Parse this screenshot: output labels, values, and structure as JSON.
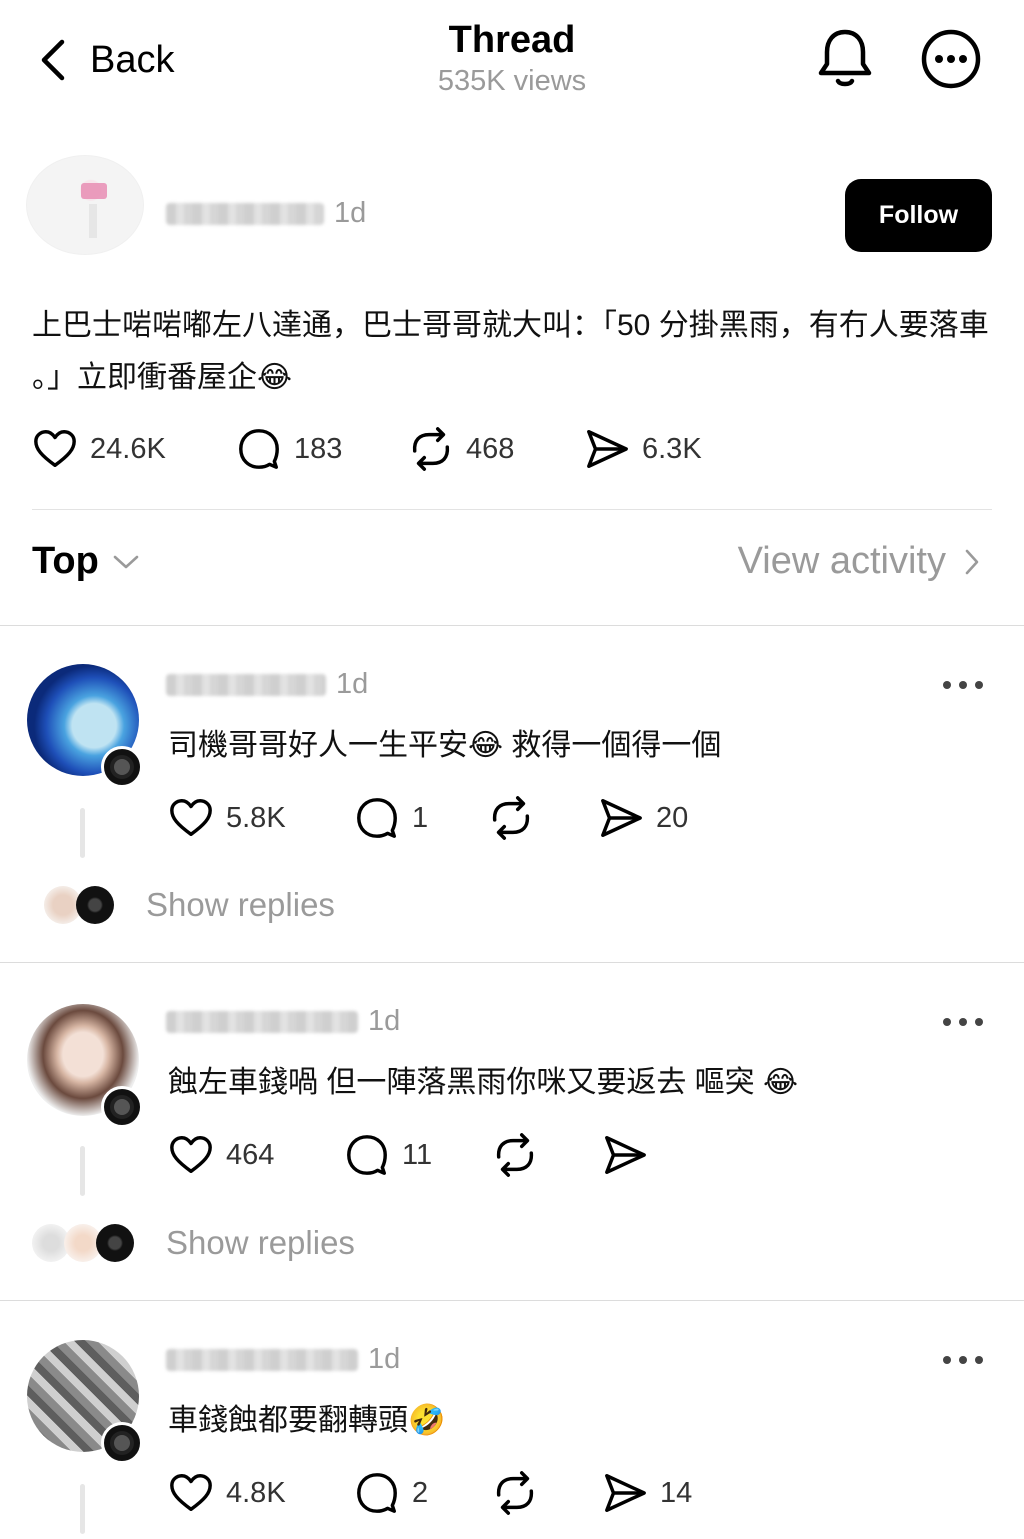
{
  "header": {
    "back_label": "Back",
    "title": "Thread",
    "views": "535K views"
  },
  "main_post": {
    "time": "1d",
    "follow_label": "Follow",
    "text": "上巴士啱啱嘟左八達通，巴士哥哥就大叫：「50 分掛黑雨，有冇人要落車 。」立即衝番屋企😂",
    "likes": "24.6K",
    "comments": "183",
    "reposts": "468",
    "shares": "6.3K"
  },
  "sort": {
    "label": "Top",
    "view_activity": "View activity"
  },
  "replies": [
    {
      "time": "1d",
      "text": "司機哥哥好人一生平安😂 救得一個得一個",
      "likes": "5.8K",
      "comments": "1",
      "reposts": "",
      "shares": "20",
      "show_replies": "Show replies"
    },
    {
      "time": "1d",
      "text": "蝕左車錢喎 但一陣落黑雨你咪又要返去 嘔突 😂",
      "likes": "464",
      "comments": "11",
      "reposts": "",
      "shares": "",
      "show_replies": "Show replies"
    },
    {
      "time": "1d",
      "text": "車錢蝕都要翻轉頭🤣",
      "likes": "4.8K",
      "comments": "2",
      "reposts": "",
      "shares": "14"
    }
  ],
  "icons": {
    "back": "chevron-left-icon",
    "bell": "bell-icon",
    "more": "more-circle-icon",
    "like": "heart-icon",
    "comment": "comment-icon",
    "repost": "repost-icon",
    "share": "send-icon"
  }
}
